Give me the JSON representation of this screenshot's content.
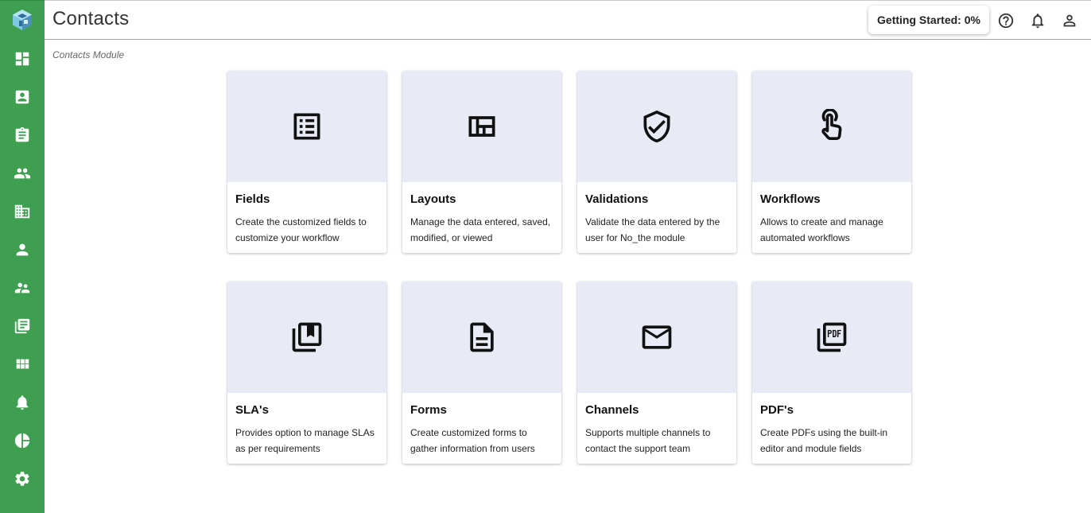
{
  "app": {
    "page_title": "Contacts",
    "breadcrumb": "Contacts Module"
  },
  "header": {
    "getting_started_label": "Getting Started: 0%",
    "icons": [
      "help-icon",
      "notifications-icon",
      "account-icon"
    ]
  },
  "sidebar": {
    "color": "#3f9f51",
    "items": [
      {
        "icon": "dashboard-icon"
      },
      {
        "icon": "contact-card-icon"
      },
      {
        "icon": "clipboard-icon"
      },
      {
        "icon": "people-icon"
      },
      {
        "icon": "building-icon"
      },
      {
        "icon": "person-icon"
      },
      {
        "icon": "supervisor-icon"
      },
      {
        "icon": "library-books-icon"
      },
      {
        "icon": "apps-grid-icon"
      },
      {
        "icon": "bell-icon"
      },
      {
        "icon": "pie-chart-icon"
      },
      {
        "icon": "settings-icon"
      }
    ]
  },
  "cards": [
    {
      "title": "Fields",
      "description": "Create the customized fields to customize your workflow",
      "icon": "fields-icon"
    },
    {
      "title": "Layouts",
      "description": "Manage the data entered, saved, modified, or viewed",
      "icon": "layouts-icon"
    },
    {
      "title": "Validations",
      "description": "Validate the data entered by the user for No_the module",
      "icon": "shield-check-icon"
    },
    {
      "title": "Workflows",
      "description": "Allows to create and manage automated workflows",
      "icon": "touch-icon"
    },
    {
      "title": "SLA's",
      "description": "Provides option to manage SLAs as per requirements",
      "icon": "collections-bookmark-icon"
    },
    {
      "title": "Forms",
      "description": "Create customized forms to gather information from users",
      "icon": "document-icon"
    },
    {
      "title": "Channels",
      "description": "Supports multiple channels to contact the support team",
      "icon": "mail-icon"
    },
    {
      "title": "PDF's",
      "description": "Create PDFs using the built-in editor and module fields",
      "icon": "pdf-icon"
    }
  ],
  "colors": {
    "card_media_bg": "#e8eaf6",
    "sidebar_bg": "#3f9f51"
  }
}
